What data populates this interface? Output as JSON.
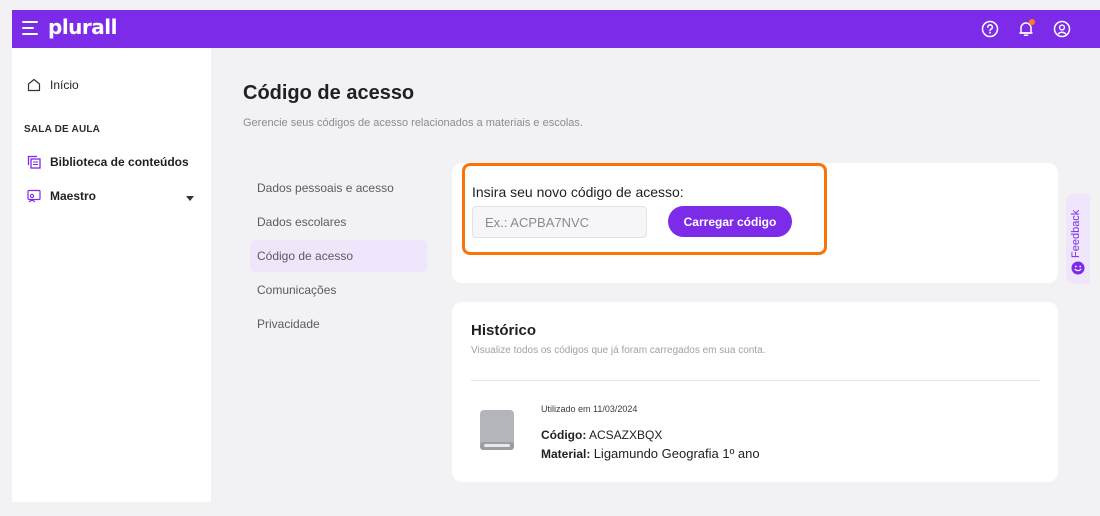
{
  "topbar": {
    "logo": "plurall",
    "icons": [
      "menu-icon",
      "help-icon",
      "bell-icon",
      "user-icon"
    ],
    "accent": "#7c2be8",
    "notification_dot": "#ff7a1a"
  },
  "sidebar": {
    "home_label": "Início",
    "section_label": "SALA DE AULA",
    "items": [
      {
        "label": "Biblioteca de conteúdos",
        "icon": "library-icon"
      },
      {
        "label": "Maestro",
        "icon": "maestro-icon"
      }
    ]
  },
  "main": {
    "title": "Código de acesso",
    "subtitle": "Gerencie seus códigos de acesso relacionados a materiais e escolas.",
    "submenu": [
      {
        "label": "Dados pessoais e acesso",
        "active": false
      },
      {
        "label": "Dados escolares",
        "active": false
      },
      {
        "label": "Código de acesso",
        "active": true
      },
      {
        "label": "Comunicações",
        "active": false
      },
      {
        "label": "Privacidade",
        "active": false
      }
    ],
    "code_card": {
      "label": "Insira seu novo código de acesso:",
      "placeholder": "Ex.: ACPBA7NVC",
      "value": "",
      "button": "Carregar código"
    },
    "history": {
      "title": "Histórico",
      "subtitle": "Visualize todos os códigos que já foram carregados em sua conta.",
      "entries": [
        {
          "used": "Utilizado em 11/03/2024",
          "code_label": "Código:",
          "code": "ACSAZXBQX",
          "material_label": "Material:",
          "material": "Ligamundo Geografia 1º ano"
        }
      ]
    }
  },
  "feedback": {
    "label": "Feedback"
  }
}
